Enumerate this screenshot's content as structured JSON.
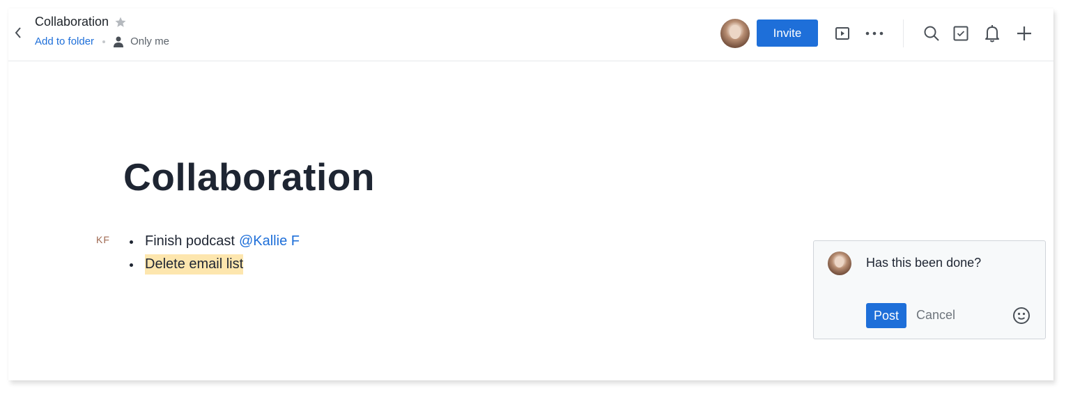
{
  "header": {
    "doc_title": "Collaboration",
    "add_to_folder": "Add to folder",
    "sharing": "Only me",
    "invite_label": "Invite",
    "icons": [
      "back-chevron-icon",
      "star-icon",
      "person-icon",
      "present-icon",
      "more-icon",
      "search-icon",
      "checklist-icon",
      "bell-icon",
      "plus-icon"
    ]
  },
  "document": {
    "heading": "Collaboration",
    "author_initials": "KF",
    "items": [
      {
        "text": "Finish podcast",
        "mention": "@Kallie F"
      },
      {
        "text": "Delete email list",
        "highlighted": true
      }
    ]
  },
  "comment": {
    "text": "Has this been done?",
    "post_label": "Post",
    "cancel_label": "Cancel"
  },
  "colors": {
    "accent": "#1e6fd9",
    "highlight": "#fde6ae",
    "initials": "#a06a52"
  }
}
